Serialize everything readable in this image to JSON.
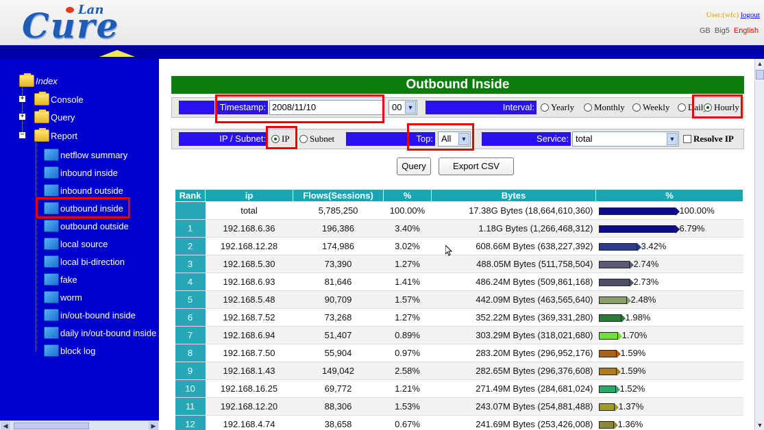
{
  "header": {
    "logo_text": "Cure",
    "logo_sub": "Lan",
    "user_label": "User:(wfc)",
    "logout_label": "logout",
    "langs": [
      "GB",
      "Big5",
      "English"
    ]
  },
  "sidebar": {
    "items": [
      {
        "label": "Index"
      },
      {
        "label": "Console"
      },
      {
        "label": "Query"
      },
      {
        "label": "Report"
      },
      {
        "label": "netflow summary"
      },
      {
        "label": "inbound inside"
      },
      {
        "label": "inbound outside"
      },
      {
        "label": "outbound inside"
      },
      {
        "label": "outbound outside"
      },
      {
        "label": "local source"
      },
      {
        "label": "local bi-direction"
      },
      {
        "label": "fake"
      },
      {
        "label": "worm"
      },
      {
        "label": "in/out-bound inside"
      },
      {
        "label": "daily in/out-bound inside"
      },
      {
        "label": "block log"
      }
    ]
  },
  "main": {
    "title": "Outbound Inside",
    "timestamp_label": "Timestamp:",
    "timestamp_value": "2008/11/10",
    "hour_value": "00",
    "interval_label": "Interval:",
    "interval_options": [
      "Yearly",
      "Monthly",
      "Weekly",
      "Daily",
      "Hourly"
    ],
    "ip_subnet_label": "IP / Subnet:",
    "ip_option": "IP",
    "subnet_option": "Subnet",
    "top_label": "Top:",
    "top_value": "All",
    "service_label": "Service:",
    "service_value": "total",
    "resolve_label": "Resolve IP",
    "query_button": "Query",
    "export_button": "Export CSV"
  },
  "table": {
    "headers": [
      "Rank",
      "ip",
      "Flows(Sessions)",
      "%",
      "Bytes",
      "%"
    ],
    "rows": [
      {
        "rank": "",
        "ip": "total",
        "flows": "5,785,250",
        "pct": "100.00%",
        "bytes": "17.38G Bytes (18,664,610,360)",
        "pct2": "100.00%",
        "share": 1.0,
        "color": "#0b0b8e"
      },
      {
        "rank": "1",
        "ip": "192.168.6.36",
        "flows": "196,386",
        "pct": "3.40%",
        "bytes": "1.18G Bytes (1,266,468,312)",
        "pct2": "6.79%",
        "share": 0.0679,
        "color": "#0b0b8e"
      },
      {
        "rank": "2",
        "ip": "192.168.12.28",
        "flows": "174,986",
        "pct": "3.02%",
        "bytes": "608.66M Bytes (638,227,392)",
        "pct2": "3.42%",
        "share": 0.0342,
        "color": "#2c3c8c"
      },
      {
        "rank": "3",
        "ip": "192.168.5.30",
        "flows": "73,390",
        "pct": "1.27%",
        "bytes": "488.05M Bytes (511,758,504)",
        "pct2": "2.74%",
        "share": 0.0274,
        "color": "#5b5b78"
      },
      {
        "rank": "4",
        "ip": "192.168.6.93",
        "flows": "81,646",
        "pct": "1.41%",
        "bytes": "486.24M Bytes (509,861,168)",
        "pct2": "2.73%",
        "share": 0.0273,
        "color": "#4e4e66"
      },
      {
        "rank": "5",
        "ip": "192.168.5.48",
        "flows": "90,709",
        "pct": "1.57%",
        "bytes": "442.09M Bytes (463,565,640)",
        "pct2": "2.48%",
        "share": 0.0248,
        "color": "#8aa06a"
      },
      {
        "rank": "6",
        "ip": "192.168.7.52",
        "flows": "73,268",
        "pct": "1.27%",
        "bytes": "352.22M Bytes (369,331,280)",
        "pct2": "1.98%",
        "share": 0.0198,
        "color": "#2a7a3a"
      },
      {
        "rank": "7",
        "ip": "192.168.6.94",
        "flows": "51,407",
        "pct": "0.89%",
        "bytes": "303.29M Bytes (318,021,680)",
        "pct2": "1.70%",
        "share": 0.017,
        "color": "#6ee03a"
      },
      {
        "rank": "8",
        "ip": "192.168.7.50",
        "flows": "55,904",
        "pct": "0.97%",
        "bytes": "283.20M Bytes (296,952,176)",
        "pct2": "1.59%",
        "share": 0.0159,
        "color": "#a8621c"
      },
      {
        "rank": "9",
        "ip": "192.168.1.43",
        "flows": "149,042",
        "pct": "2.58%",
        "bytes": "282.65M Bytes (296,376,608)",
        "pct2": "1.59%",
        "share": 0.0159,
        "color": "#b07a20"
      },
      {
        "rank": "10",
        "ip": "192.168.16.25",
        "flows": "69,772",
        "pct": "1.21%",
        "bytes": "271.49M Bytes (284,681,024)",
        "pct2": "1.52%",
        "share": 0.0152,
        "color": "#2aa86a"
      },
      {
        "rank": "11",
        "ip": "192.168.12.20",
        "flows": "88,306",
        "pct": "1.53%",
        "bytes": "243.07M Bytes (254,881,488)",
        "pct2": "1.37%",
        "share": 0.0137,
        "color": "#a09a2a"
      },
      {
        "rank": "12",
        "ip": "192.168.4.74",
        "flows": "38,658",
        "pct": "0.67%",
        "bytes": "241.69M Bytes (253,426,008)",
        "pct2": "1.36%",
        "share": 0.0136,
        "color": "#8c8a38"
      }
    ]
  }
}
